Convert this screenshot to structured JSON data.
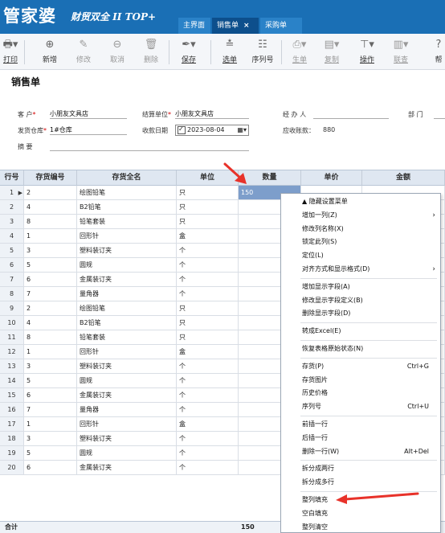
{
  "header": {
    "logo": "管家婆",
    "logo_sub": "财贸双全 II TOP+",
    "tabs": [
      {
        "label": "主界面",
        "closable": false
      },
      {
        "label": "销售单",
        "closable": true,
        "active": true
      },
      {
        "label": "采购单",
        "closable": true
      }
    ],
    "close_glyph": "×"
  },
  "toolbar": {
    "buttons": [
      {
        "icon": "print-icon",
        "label": "打印"
      },
      {
        "icon": "add-icon",
        "label": "新增"
      },
      {
        "icon": "edit-icon",
        "label": "修改"
      },
      {
        "icon": "cancel-icon",
        "label": "取消"
      },
      {
        "icon": "delete-icon",
        "label": "删除"
      },
      {
        "icon": "save-icon",
        "label": "保存"
      },
      {
        "icon": "select-icon",
        "label": "选单"
      },
      {
        "icon": "serial-icon",
        "label": "序列号"
      },
      {
        "icon": "generate-icon",
        "label": "生单"
      },
      {
        "icon": "copy-icon",
        "label": "复制"
      },
      {
        "icon": "operate-icon",
        "label": "操作"
      },
      {
        "icon": "link-icon",
        "label": "联查"
      },
      {
        "icon": "help-icon",
        "label": "帮"
      }
    ]
  },
  "page_title": "销售单",
  "form": {
    "customer_label": "客    户",
    "customer_value": "小朋友文具店",
    "settle_label": "结算单位",
    "settle_value": "小朋友文具店",
    "handler_label": "经 办 人",
    "dept_label": "部    门",
    "warehouse_label": "发货仓库",
    "warehouse_value": "1#仓库",
    "date_label": "收款日期",
    "date_value": "2023-08-04",
    "receivable_label": "应收账款：",
    "receivable_value": "880",
    "summary_label": "摘    要",
    "required_mark": "*"
  },
  "grid": {
    "columns": [
      "行号",
      "存货编号",
      "存货全名",
      "单位",
      "数量",
      "单价",
      "金额"
    ],
    "rows": [
      {
        "no": "1",
        "code": "2",
        "name": "绘图铅笔",
        "unit": "只",
        "qty": "150"
      },
      {
        "no": "2",
        "code": "4",
        "name": "B2铅笔",
        "unit": "只",
        "qty": ""
      },
      {
        "no": "3",
        "code": "8",
        "name": "铅笔套装",
        "unit": "只",
        "qty": ""
      },
      {
        "no": "4",
        "code": "1",
        "name": "回形针",
        "unit": "盒",
        "qty": ""
      },
      {
        "no": "5",
        "code": "3",
        "name": "塑料装订夹",
        "unit": "个",
        "qty": ""
      },
      {
        "no": "6",
        "code": "5",
        "name": "圆规",
        "unit": "个",
        "qty": ""
      },
      {
        "no": "7",
        "code": "6",
        "name": "金属装订夹",
        "unit": "个",
        "qty": ""
      },
      {
        "no": "8",
        "code": "7",
        "name": "量角器",
        "unit": "个",
        "qty": ""
      },
      {
        "no": "9",
        "code": "2",
        "name": "绘图铅笔",
        "unit": "只",
        "qty": ""
      },
      {
        "no": "10",
        "code": "4",
        "name": "B2铅笔",
        "unit": "只",
        "qty": ""
      },
      {
        "no": "11",
        "code": "8",
        "name": "铅笔套装",
        "unit": "只",
        "qty": ""
      },
      {
        "no": "12",
        "code": "1",
        "name": "回形针",
        "unit": "盒",
        "qty": ""
      },
      {
        "no": "13",
        "code": "3",
        "name": "塑料装订夹",
        "unit": "个",
        "qty": ""
      },
      {
        "no": "14",
        "code": "5",
        "name": "圆规",
        "unit": "个",
        "qty": ""
      },
      {
        "no": "15",
        "code": "6",
        "name": "金属装订夹",
        "unit": "个",
        "qty": ""
      },
      {
        "no": "16",
        "code": "7",
        "name": "量角器",
        "unit": "个",
        "qty": ""
      },
      {
        "no": "17",
        "code": "1",
        "name": "回形针",
        "unit": "盒",
        "qty": ""
      },
      {
        "no": "18",
        "code": "3",
        "name": "塑料装订夹",
        "unit": "个",
        "qty": ""
      },
      {
        "no": "19",
        "code": "5",
        "name": "圆规",
        "unit": "个",
        "qty": ""
      },
      {
        "no": "20",
        "code": "6",
        "name": "金属装订夹",
        "unit": "个",
        "qty": ""
      }
    ],
    "total_label": "合计",
    "total_qty": "150"
  },
  "context_menu": {
    "items": [
      {
        "label": "▲ 隐藏设置菜单",
        "shortcut": "",
        "submenu": false,
        "sep_after": false
      },
      {
        "label": "增加一列(Z)",
        "shortcut": "",
        "submenu": true,
        "sep_after": false
      },
      {
        "label": "修改列名称(X)",
        "shortcut": "",
        "submenu": false,
        "sep_after": false
      },
      {
        "label": "锁定此列(S)",
        "shortcut": "",
        "submenu": false,
        "sep_after": false
      },
      {
        "label": "定位(L)",
        "shortcut": "",
        "submenu": false,
        "sep_after": false
      },
      {
        "label": "对齐方式和显示格式(D)",
        "shortcut": "",
        "submenu": true,
        "sep_after": true
      },
      {
        "label": "增加显示字段(A)",
        "shortcut": "",
        "submenu": false,
        "sep_after": false
      },
      {
        "label": "修改显示字段定义(B)",
        "shortcut": "",
        "submenu": false,
        "sep_after": false
      },
      {
        "label": "删除显示字段(D)",
        "shortcut": "",
        "submenu": false,
        "sep_after": true
      },
      {
        "label": "转成Excel(E)",
        "shortcut": "",
        "submenu": false,
        "sep_after": true
      },
      {
        "label": "恢复表格原始状态(N)",
        "shortcut": "",
        "submenu": false,
        "sep_after": true
      },
      {
        "label": "存货(P)",
        "shortcut": "Ctrl+G",
        "submenu": false,
        "sep_after": false
      },
      {
        "label": "存货图片",
        "shortcut": "",
        "submenu": false,
        "sep_after": false
      },
      {
        "label": "历史价格",
        "shortcut": "",
        "submenu": false,
        "sep_after": false
      },
      {
        "label": "序列号",
        "shortcut": "Ctrl+U",
        "submenu": false,
        "sep_after": true
      },
      {
        "label": "前插一行",
        "shortcut": "",
        "submenu": false,
        "sep_after": false
      },
      {
        "label": "后插一行",
        "shortcut": "",
        "submenu": false,
        "sep_after": false
      },
      {
        "label": "删除一行(W)",
        "shortcut": "Alt+Del",
        "submenu": false,
        "sep_after": true
      },
      {
        "label": "拆分成两行",
        "shortcut": "",
        "submenu": false,
        "sep_after": false
      },
      {
        "label": "拆分成多行",
        "shortcut": "",
        "submenu": false,
        "sep_after": true
      },
      {
        "label": "整列填充",
        "shortcut": "",
        "submenu": false,
        "sep_after": false
      },
      {
        "label": "空白填充",
        "shortcut": "",
        "submenu": false,
        "sep_after": false
      },
      {
        "label": "整列清空",
        "shortcut": "",
        "submenu": false,
        "sep_after": false
      }
    ]
  },
  "colors": {
    "header_bg": "#1a6fb5",
    "active_tab": "#0d4f8c",
    "annotation_red": "#e8322a",
    "selected_cell": "#7d9ecb"
  }
}
